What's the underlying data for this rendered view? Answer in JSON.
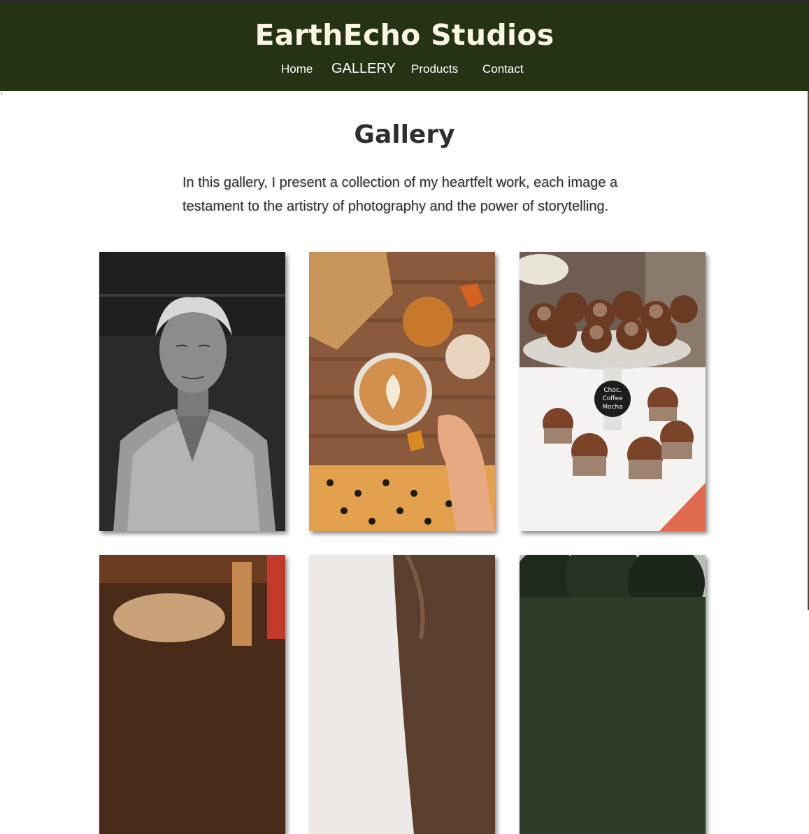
{
  "site": {
    "title": "EarthEcho Studios"
  },
  "nav": {
    "items": [
      {
        "label": "Home"
      },
      {
        "label": "GALLERY"
      },
      {
        "label": "Products"
      },
      {
        "label": "Contact"
      }
    ],
    "active": "GALLERY"
  },
  "page": {
    "heading": "Gallery",
    "intro": "In this gallery, I present a collection of my heartfelt work, each image a testament to the artistry of photography and the power of storytelling."
  },
  "gallery": {
    "images": [
      {
        "subject": "portrait-elderly-woman"
      },
      {
        "subject": "latte-with-pumpkins"
      },
      {
        "subject": "chocolate-cupcakes",
        "sign_text": [
          "Choc.",
          "Coffee",
          "Mocha"
        ]
      },
      {
        "subject": "food-on-table"
      },
      {
        "subject": "woman-hair"
      },
      {
        "subject": "trees"
      }
    ]
  },
  "colors": {
    "header_bg": "#263214",
    "title": "#fbf6e3",
    "heading": "#2e2e2e"
  }
}
